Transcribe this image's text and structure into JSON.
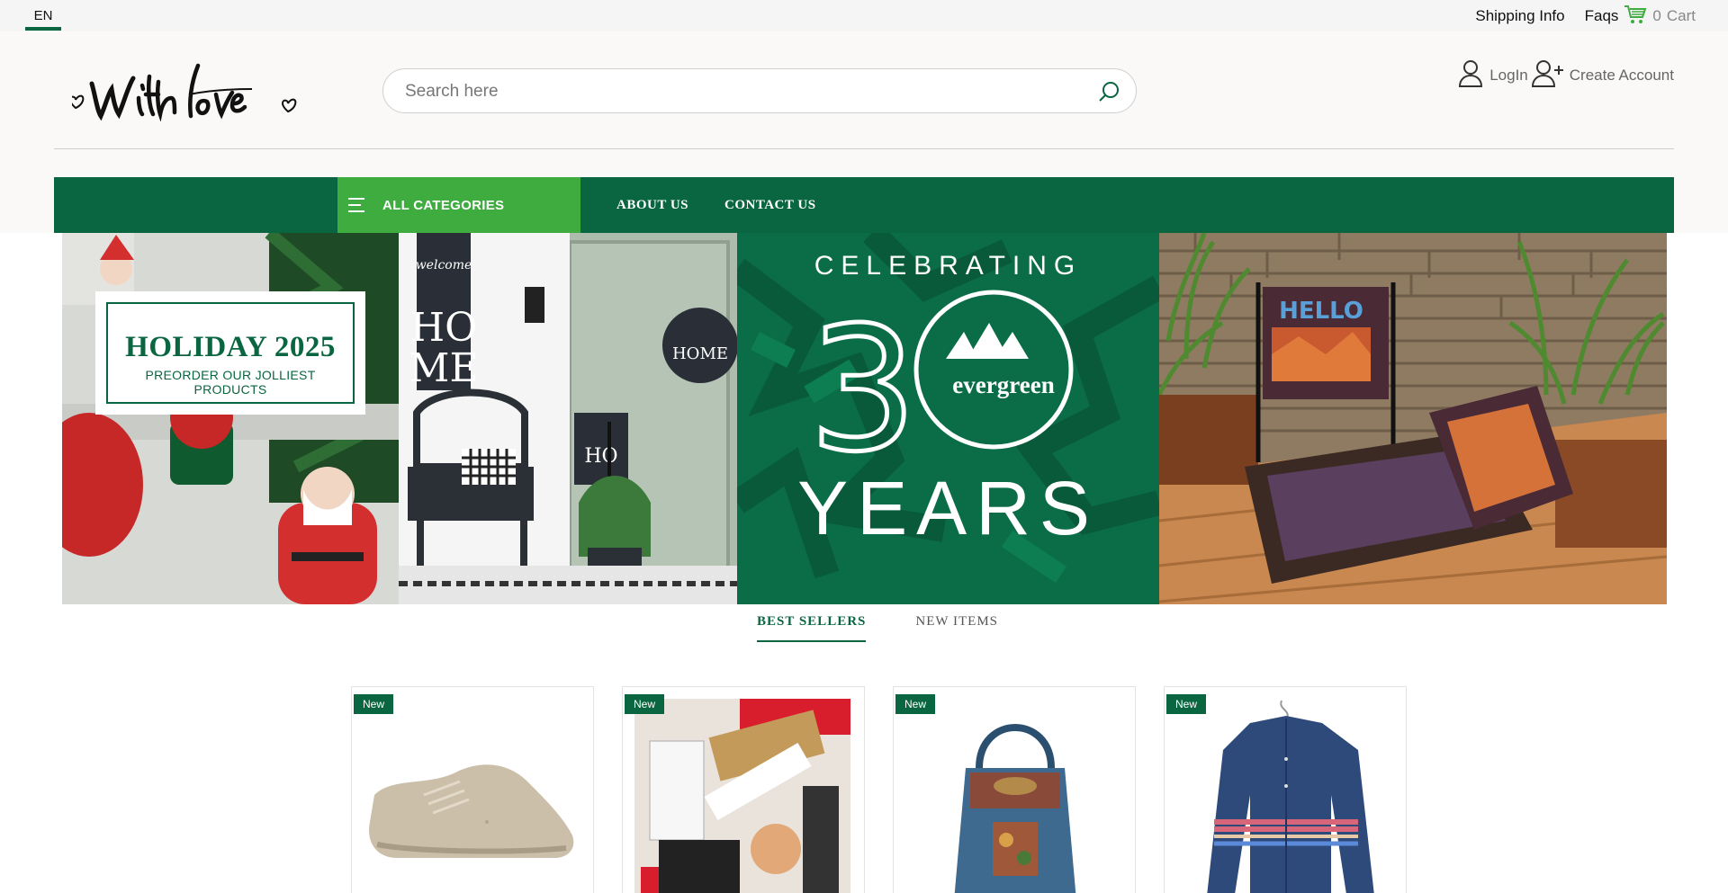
{
  "topbar": {
    "language": "EN",
    "shipping_info": "Shipping Info",
    "faqs": "Faqs",
    "cart_count": "0",
    "cart_label": "Cart"
  },
  "header": {
    "logo_text": "With love",
    "search_placeholder": "Search here",
    "login": "LogIn",
    "create_account": "Create Account"
  },
  "nav": {
    "all_categories": "ALL CATEGORIES",
    "links": [
      "ABOUT US",
      "CONTACT US"
    ]
  },
  "banner": {
    "holiday_title": "HOLIDAY 2025",
    "holiday_subtitle": "PREORDER OUR JOLLIEST PRODUCTS",
    "celebrating": "CELEBRATING",
    "brand_mark": "evergreen",
    "years": "YEARS",
    "flag_text": "HELLO"
  },
  "tabs": [
    "BEST SELLERS",
    "NEW ITEMS"
  ],
  "active_tab": "BEST SELLERS",
  "products": [
    {
      "badge": "New",
      "image": "beige-sneaker"
    },
    {
      "badge": "New",
      "image": "cosmetics-bundle"
    },
    {
      "badge": "New",
      "image": "denim-tote-bag"
    },
    {
      "badge": "New",
      "image": "denim-striped-shirt"
    }
  ],
  "colors": {
    "brand_green": "#0a6641",
    "accent_green": "#3fac3f",
    "topbar_bg": "#f5f5f5",
    "header_bg": "#faf9f7"
  }
}
